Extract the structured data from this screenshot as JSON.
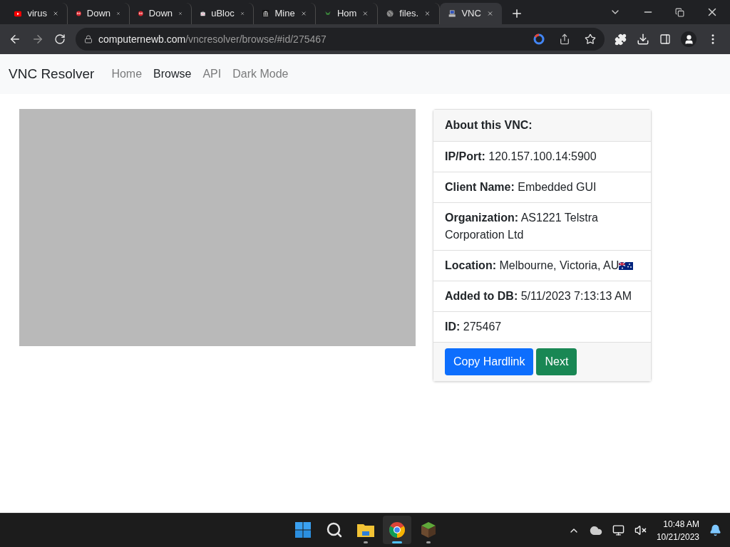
{
  "browser": {
    "tabs": [
      {
        "title": "virus",
        "kind": "video",
        "selected": false
      },
      {
        "title": "Down",
        "kind": "mega",
        "selected": false
      },
      {
        "title": "Down",
        "kind": "mega",
        "selected": false
      },
      {
        "title": "uBloc",
        "kind": "bag",
        "selected": false
      },
      {
        "title": "Mine",
        "kind": "building",
        "selected": false
      },
      {
        "title": "Hom",
        "kind": "leaf",
        "selected": false
      },
      {
        "title": "files.",
        "kind": "globe",
        "selected": false
      },
      {
        "title": "VNC",
        "kind": "computer",
        "selected": true
      }
    ],
    "address": {
      "domain": "computernewb.com",
      "path": "/vncresolver/browse/#id/275467"
    }
  },
  "navbar": {
    "brand": "VNC Resolver",
    "links": [
      {
        "label": "Home",
        "selected": false
      },
      {
        "label": "Browse",
        "selected": true
      },
      {
        "label": "API",
        "selected": false
      },
      {
        "label": "Dark Mode",
        "selected": false
      }
    ]
  },
  "card": {
    "title": "About this VNC:",
    "rows": [
      {
        "label": "IP/Port:",
        "value": "120.157.100.14:5900"
      },
      {
        "label": "Client Name:",
        "value": "Embedded GUI"
      },
      {
        "label": "Organization:",
        "value": "AS1221 Telstra Corporation Ltd"
      },
      {
        "label": "Location:",
        "value": "Melbourne, Victoria, AU",
        "flag": true
      },
      {
        "label": "Added to DB:",
        "value": "5/11/2023 7:13:13 AM"
      },
      {
        "label": "ID:",
        "value": "275467"
      }
    ],
    "buttons": [
      {
        "label": "Copy Hardlink",
        "kind": "primary"
      },
      {
        "label": "Next",
        "kind": "success"
      }
    ]
  },
  "taskbar": {
    "apps": [
      {
        "kind": "start",
        "selected": false,
        "running": false
      },
      {
        "kind": "search",
        "selected": false,
        "running": false
      },
      {
        "kind": "folder",
        "selected": false,
        "running": true
      },
      {
        "kind": "chrome",
        "selected": true,
        "running": true
      },
      {
        "kind": "block",
        "selected": false,
        "running": true
      }
    ],
    "time": "10:48 AM",
    "date": "10/21/2023"
  }
}
